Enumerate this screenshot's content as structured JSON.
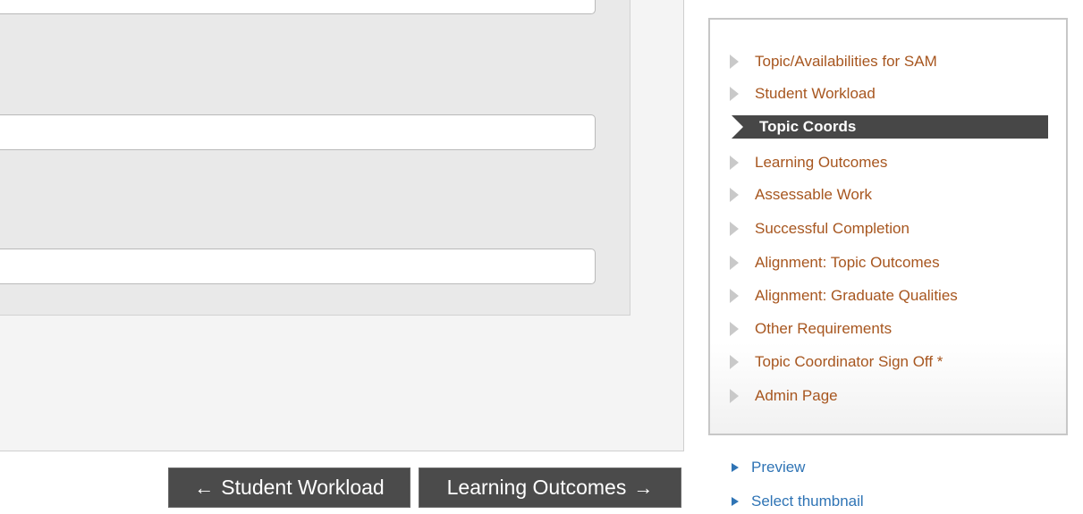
{
  "navigation": {
    "prev_arrow": "←",
    "prev_label": "Student Workload",
    "next_label": "Learning Outcomes",
    "next_arrow": "→"
  },
  "sidebar": {
    "items": [
      {
        "label": "Topic/Availabilities for SAM",
        "active": false
      },
      {
        "label": "Student Workload",
        "active": false
      },
      {
        "label": "Topic Coords",
        "active": true
      },
      {
        "label": "Learning Outcomes",
        "active": false
      },
      {
        "label": "Assessable Work",
        "active": false
      },
      {
        "label": "Successful Completion",
        "active": false
      },
      {
        "label": "Alignment: Topic Outcomes",
        "active": false
      },
      {
        "label": "Alignment: Graduate Qualities",
        "active": false
      },
      {
        "label": "Other Requirements",
        "active": false
      },
      {
        "label": "Topic Coordinator Sign Off *",
        "active": false
      },
      {
        "label": "Admin Page",
        "active": false
      }
    ]
  },
  "links": {
    "preview": "Preview",
    "select_thumbnail": "Select thumbnail"
  },
  "colors": {
    "menu_link": "#a7561f",
    "active_bg": "#474747",
    "action_link": "#2f74b5",
    "button_bg": "#4b4b4b"
  }
}
